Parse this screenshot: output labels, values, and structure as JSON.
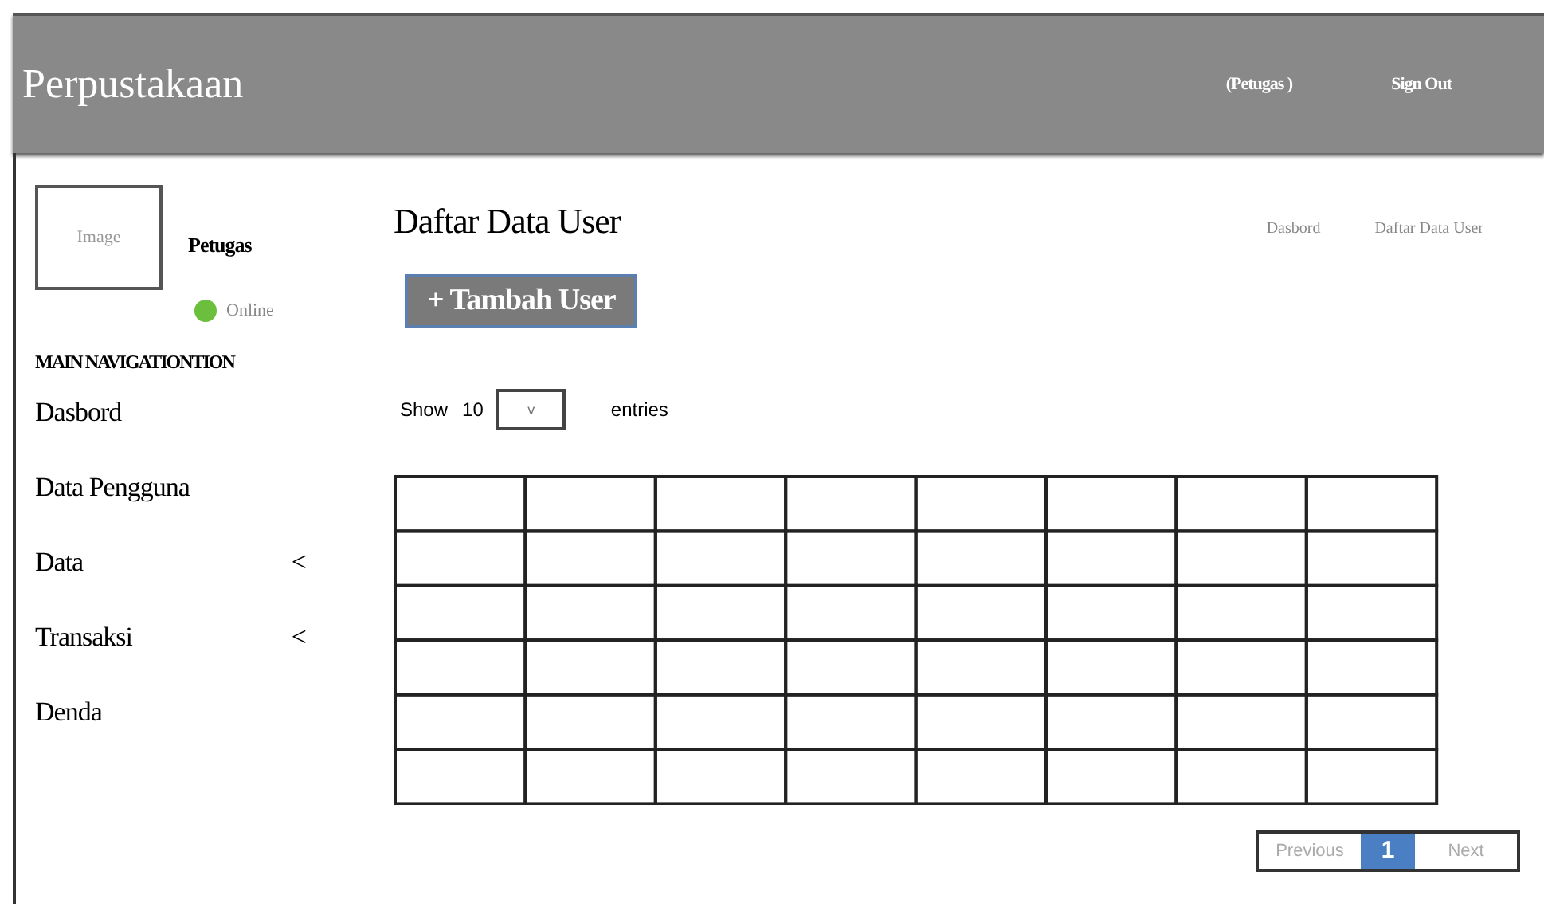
{
  "header": {
    "title": "Perpustakaan",
    "user": "(Petugas )",
    "sign_out": "Sign Out"
  },
  "sidebar": {
    "avatar_placeholder": "Image",
    "user_name": "Petugas",
    "status": {
      "label": "Online",
      "online": true
    },
    "section_title": "MAIN NAVIGATIONTION",
    "items": [
      {
        "label": "Dasbord"
      },
      {
        "label": "Data Pengguna"
      },
      {
        "label": "Data",
        "chevron": "<"
      },
      {
        "label": "Transaksi",
        "chevron": "<"
      },
      {
        "label": "Denda"
      }
    ]
  },
  "page": {
    "title": "Daftar Data User",
    "breadcrumbs": [
      "Dasbord",
      "Daftar Data User"
    ],
    "add_button": "+ Tambah User",
    "entries": {
      "show": "Show",
      "value": "10",
      "caret": "v",
      "suffix": "entries"
    },
    "pagination": [
      {
        "label": "Previous",
        "selected": false
      },
      {
        "label": "1",
        "selected": true
      },
      {
        "label": "Next",
        "selected": false
      }
    ]
  }
}
